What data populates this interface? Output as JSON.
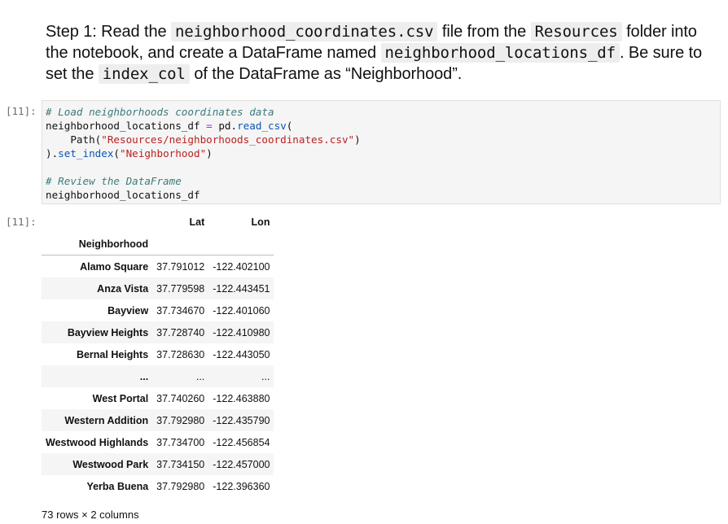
{
  "markdown": {
    "p1": "Step 1: Read the ",
    "c1": "neighborhood_coordinates.csv",
    "p2": " file from the ",
    "c2": "Resources",
    "p3": " folder into the notebook, and create a DataFrame named ",
    "c3": "neighborhood_locations_df",
    "p4": ". Be sure to set the ",
    "c4": "index_col",
    "p5": " of the DataFrame as “Neighborhood”."
  },
  "cell": {
    "in_prompt": "[11]:",
    "out_prompt": "[11]:",
    "code": {
      "comment1": "# Load neighborhoods coordinates data",
      "var1": "neighborhood_locations_df",
      "eq": "=",
      "pd": " pd.",
      "read_csv": "read_csv",
      "open_paren": "(",
      "path_fn": "    Path(",
      "path_str": "\"Resources/neighborhoods_coordinates.csv\"",
      "close_paren": ")",
      "close2": ").",
      "set_index": "set_index",
      "open2": "(",
      "idx_str": "\"Neighborhood\"",
      "close3": ")",
      "comment2": "# Review the DataFrame",
      "var2": "neighborhood_locations_df"
    }
  },
  "dataframe": {
    "columns": [
      "Lat",
      "Lon"
    ],
    "index_name": "Neighborhood",
    "rows": [
      {
        "name": "Alamo Square",
        "lat": "37.791012",
        "lon": "-122.402100"
      },
      {
        "name": "Anza Vista",
        "lat": "37.779598",
        "lon": "-122.443451"
      },
      {
        "name": "Bayview",
        "lat": "37.734670",
        "lon": "-122.401060"
      },
      {
        "name": "Bayview Heights",
        "lat": "37.728740",
        "lon": "-122.410980"
      },
      {
        "name": "Bernal Heights",
        "lat": "37.728630",
        "lon": "-122.443050"
      },
      {
        "name": "...",
        "lat": "...",
        "lon": "..."
      },
      {
        "name": "West Portal",
        "lat": "37.740260",
        "lon": "-122.463880"
      },
      {
        "name": "Western Addition",
        "lat": "37.792980",
        "lon": "-122.435790"
      },
      {
        "name": "Westwood Highlands",
        "lat": "37.734700",
        "lon": "-122.456854"
      },
      {
        "name": "Westwood Park",
        "lat": "37.734150",
        "lon": "-122.457000"
      },
      {
        "name": "Yerba Buena",
        "lat": "37.792980",
        "lon": "-122.396360"
      }
    ],
    "shape": "73 rows × 2 columns"
  }
}
